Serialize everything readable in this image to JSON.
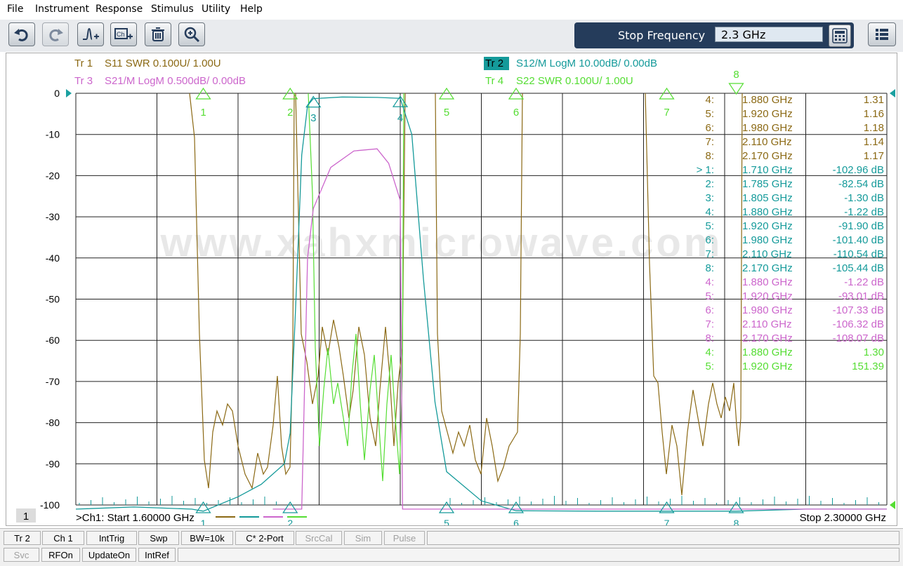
{
  "menu": [
    "File",
    "Instrument",
    "Response",
    "Stimulus",
    "Utility",
    "Help"
  ],
  "toolbar": {
    "buttons": [
      "undo-icon",
      "redo-icon",
      "marker-add-icon",
      "channel-add-icon",
      "trash-icon",
      "zoom-icon"
    ],
    "stop_label": "Stop Frequency",
    "stop_value": "2.3 GHz"
  },
  "traces": [
    {
      "label": "Tr 1",
      "desc": "S11 SWR 0.100U/  1.00U",
      "color": "#8b6914"
    },
    {
      "label": "Tr 2",
      "desc": "S12/M LogM 10.00dB/  0.00dB",
      "color": "#149a9a",
      "active": true
    },
    {
      "label": "Tr 3",
      "desc": "S21/M LogM 0.500dB/  0.00dB",
      "color": "#cc66cc"
    },
    {
      "label": "Tr 4",
      "desc": "S22 SWR 0.100U/  1.00U",
      "color": "#55dd33"
    }
  ],
  "chart_data": {
    "type": "line",
    "y_ticks": [
      "0",
      "-10",
      "-20",
      "-30",
      "-40",
      "-50",
      "-60",
      "-70",
      "-80",
      "-90",
      "-100"
    ],
    "ylim": [
      -100,
      0
    ],
    "xlim": [
      1.6,
      2.3
    ],
    "x_unit": "GHz",
    "grid": true,
    "series": [
      {
        "name": "Tr 1",
        "color": "#8b6914"
      },
      {
        "name": "Tr 2",
        "color": "#149a9a"
      },
      {
        "name": "Tr 3",
        "color": "#cc66cc"
      },
      {
        "name": "Tr 4",
        "color": "#55dd33"
      }
    ],
    "trace_points": {
      "tr2": [
        [
          1.6,
          -101
        ],
        [
          1.65,
          -100.5
        ],
        [
          1.7,
          -101
        ],
        [
          1.71,
          -102.96
        ],
        [
          1.74,
          -98
        ],
        [
          1.76,
          -95
        ],
        [
          1.78,
          -90
        ],
        [
          1.785,
          -82.54
        ],
        [
          1.79,
          -50
        ],
        [
          1.795,
          -15
        ],
        [
          1.8,
          -3
        ],
        [
          1.805,
          -1.3
        ],
        [
          1.83,
          -0.9
        ],
        [
          1.86,
          -1.0
        ],
        [
          1.88,
          -1.22
        ],
        [
          1.89,
          -10
        ],
        [
          1.9,
          -45
        ],
        [
          1.91,
          -75
        ],
        [
          1.92,
          -91.9
        ],
        [
          1.95,
          -99
        ],
        [
          1.98,
          -101.4
        ],
        [
          2.05,
          -103
        ],
        [
          2.11,
          -110.54
        ],
        [
          2.17,
          -105.44
        ],
        [
          2.23,
          -101
        ],
        [
          2.3,
          -101
        ]
      ],
      "tr3": [
        [
          1.77,
          -101
        ],
        [
          1.795,
          -101
        ],
        [
          1.8,
          -40
        ],
        [
          1.805,
          -28
        ],
        [
          1.82,
          -18
        ],
        [
          1.84,
          -14
        ],
        [
          1.86,
          -13.5
        ],
        [
          1.87,
          -17
        ],
        [
          1.88,
          -26
        ],
        [
          1.882,
          -101
        ],
        [
          1.92,
          -101
        ],
        [
          2.3,
          -101
        ]
      ]
    },
    "markers": {
      "top": [
        {
          "n": "1",
          "f": 1.71
        },
        {
          "n": "2",
          "f": 1.785
        },
        {
          "n": "5",
          "f": 1.92
        },
        {
          "n": "6",
          "f": 1.98
        },
        {
          "n": "7",
          "f": 2.11
        }
      ],
      "tr2_on_trace": [
        {
          "n": "3",
          "f": 1.805,
          "v": -1.3
        },
        {
          "n": "4",
          "f": 1.88,
          "v": -1.22
        }
      ],
      "bottom": [
        {
          "n": "1",
          "f": 1.71
        },
        {
          "n": "2",
          "f": 1.785
        },
        {
          "n": "5",
          "f": 1.92
        },
        {
          "n": "6",
          "f": 1.98
        },
        {
          "n": "7",
          "f": 2.11
        },
        {
          "n": "8",
          "f": 2.17
        }
      ]
    },
    "start_label": ">Ch1:  Start  1.60000 GHz",
    "stop_label": "Stop  2.30000 GHz",
    "channel_badge": "1",
    "watermark": "www.xahxmicrowave.com"
  },
  "marker_table": [
    {
      "n": "4:",
      "f": "1.880  GHz",
      "v": "1.31",
      "color": "#8b6914"
    },
    {
      "n": "5:",
      "f": "1.920  GHz",
      "v": "1.16",
      "color": "#8b6914"
    },
    {
      "n": "6:",
      "f": "1.980  GHz",
      "v": "1.18",
      "color": "#8b6914"
    },
    {
      "n": "7:",
      "f": "2.110  GHz",
      "v": "1.14",
      "color": "#8b6914"
    },
    {
      "n": "8:",
      "f": "2.170  GHz",
      "v": "1.17",
      "color": "#8b6914"
    },
    {
      "n": "> 1:",
      "f": "1.710  GHz",
      "v": "-102.96 dB",
      "color": "#149a9a"
    },
    {
      "n": "2:",
      "f": "1.785  GHz",
      "v": "-82.54 dB",
      "color": "#149a9a"
    },
    {
      "n": "3:",
      "f": "1.805  GHz",
      "v": "-1.30 dB",
      "color": "#149a9a"
    },
    {
      "n": "4:",
      "f": "1.880  GHz",
      "v": "-1.22 dB",
      "color": "#149a9a"
    },
    {
      "n": "5:",
      "f": "1.920  GHz",
      "v": "-91.90 dB",
      "color": "#149a9a"
    },
    {
      "n": "6:",
      "f": "1.980  GHz",
      "v": "-101.40 dB",
      "color": "#149a9a"
    },
    {
      "n": "7:",
      "f": "2.110  GHz",
      "v": "-110.54 dB",
      "color": "#149a9a"
    },
    {
      "n": "8:",
      "f": "2.170  GHz",
      "v": "-105.44 dB",
      "color": "#149a9a"
    },
    {
      "n": "4:",
      "f": "1.880  GHz",
      "v": "-1.22 dB",
      "color": "#cc66cc"
    },
    {
      "n": "5:",
      "f": "1.920  GHz",
      "v": "-93.01 dB",
      "color": "#cc66cc"
    },
    {
      "n": "6:",
      "f": "1.980  GHz",
      "v": "-107.33 dB",
      "color": "#cc66cc"
    },
    {
      "n": "7:",
      "f": "2.110  GHz",
      "v": "-106.32 dB",
      "color": "#cc66cc"
    },
    {
      "n": "8:",
      "f": "2.170  GHz",
      "v": "-108.07 dB",
      "color": "#cc66cc"
    },
    {
      "n": "4:",
      "f": "1.880  GHz",
      "v": "1.30",
      "color": "#55dd33"
    },
    {
      "n": "5:",
      "f": "1.920  GHz",
      "v": "151.39",
      "color": "#55dd33"
    }
  ],
  "status_row1": [
    "Tr 2",
    "Ch 1",
    "IntTrig",
    "Swp",
    "BW=10k",
    "C* 2-Port",
    "SrcCal",
    "Sim",
    "Pulse"
  ],
  "status_row1_disabled": [
    "SrcCal",
    "Sim",
    "Pulse"
  ],
  "status_row2": [
    "Svc",
    "RFOn",
    "UpdateOn",
    "IntRef"
  ],
  "status_row2_disabled": [
    "Svc"
  ]
}
